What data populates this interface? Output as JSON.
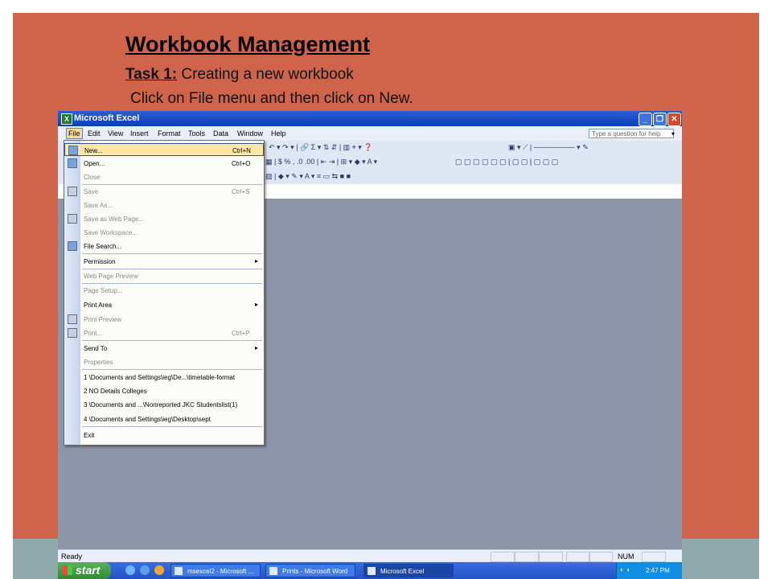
{
  "slide": {
    "title": "Workbook Management",
    "task_label": "Task 1:",
    "task_text": " Creating a new workbook",
    "instruction": "Click on File menu and then click on New."
  },
  "window": {
    "title": "Microsoft Excel",
    "help_placeholder": "Type a question for help",
    "buttons": {
      "minimize": "_",
      "restore": "❐",
      "close": "✕"
    }
  },
  "menubar": [
    "File",
    "Edit",
    "View",
    "Insert",
    "Format",
    "Tools",
    "Data",
    "Window",
    "Help"
  ],
  "toolbar": {
    "row1": "↶ ▾ ↷ ▾ | 🔗  Σ ▾ ⇅ ⇵ | ▥ ⌖   ▾  ❓",
    "row1b": "▣ ▾ ⟋ |  ────────  ▾  ✎",
    "row2": "▦ | $ % , .0 .00 | ⇤ ⇥ | ⊞ ▾ ◆ ▾ A ▾",
    "row2b": "▢ ▢ ▢ ▢ ▢ ▢ | ▢ ▢ | ▢ ▢ ▢",
    "row3": "▨ | ◆ ▾ ✎ ▾ A ▾ ≡ ▭ ⇆ ■ ■"
  },
  "file_menu": {
    "items": [
      {
        "label": "New...",
        "shortcut": "Ctrl+N",
        "icon": "new-document-icon",
        "state": "highlighted"
      },
      {
        "label": "Open...",
        "shortcut": "Ctrl+O",
        "icon": "open-folder-icon",
        "state": "normal"
      },
      {
        "label": "Close",
        "shortcut": "",
        "icon": "",
        "state": "disabled"
      },
      {
        "label": "Save",
        "shortcut": "Ctrl+S",
        "icon": "save-icon",
        "state": "disabled"
      },
      {
        "label": "Save As...",
        "shortcut": "",
        "icon": "",
        "state": "disabled"
      },
      {
        "label": "Save as Web Page...",
        "shortcut": "",
        "icon": "web-page-icon",
        "state": "disabled"
      },
      {
        "label": "Save Workspace...",
        "shortcut": "",
        "icon": "",
        "state": "disabled"
      },
      {
        "label": "File Search...",
        "shortcut": "",
        "icon": "file-search-icon",
        "state": "normal"
      },
      {
        "label": "Permission",
        "shortcut": "",
        "icon": "",
        "state": "submenu"
      },
      {
        "label": "Web Page Preview",
        "shortcut": "",
        "icon": "",
        "state": "disabled"
      },
      {
        "label": "Page Setup...",
        "shortcut": "",
        "icon": "",
        "state": "disabled"
      },
      {
        "label": "Print Area",
        "shortcut": "",
        "icon": "",
        "state": "submenu"
      },
      {
        "label": "Print Preview",
        "shortcut": "",
        "icon": "print-preview-icon",
        "state": "disabled"
      },
      {
        "label": "Print...",
        "shortcut": "Ctrl+P",
        "icon": "print-icon",
        "state": "disabled"
      },
      {
        "label": "Send To",
        "shortcut": "",
        "icon": "",
        "state": "submenu"
      },
      {
        "label": "Properties",
        "shortcut": "",
        "icon": "",
        "state": "disabled"
      },
      {
        "label": "1 \\Documents and Settings\\ieg\\De...\\timetable-format",
        "shortcut": "",
        "icon": "",
        "state": "normal"
      },
      {
        "label": "2 NO Details Colleges",
        "shortcut": "",
        "icon": "",
        "state": "normal"
      },
      {
        "label": "3 \\Documents and ...\\Nonreported JKC Studentslist(1)",
        "shortcut": "",
        "icon": "",
        "state": "normal"
      },
      {
        "label": "4 \\Documents and Settings\\ieg\\Desktop\\sept",
        "shortcut": "",
        "icon": "",
        "state": "normal"
      },
      {
        "label": "Exit",
        "shortcut": "",
        "icon": "",
        "state": "normal"
      }
    ],
    "submenu_arrow": "▸"
  },
  "statusbar": {
    "status": "Ready",
    "num": "NUM"
  },
  "taskbar": {
    "start": "start",
    "tasks": [
      "msexcel2 - Microsoft ...",
      "Prints - Microsoft Word",
      "Microsoft Excel"
    ],
    "clock": "2:47 PM",
    "tray_icons": "◐ ◑"
  },
  "colors": {
    "slide_bg": "#d0644a",
    "band": "#8fa9ac",
    "workspace": "#8c94a8",
    "titlebar": "#0a3fb5",
    "menu_highlight": "#fde7a8"
  }
}
